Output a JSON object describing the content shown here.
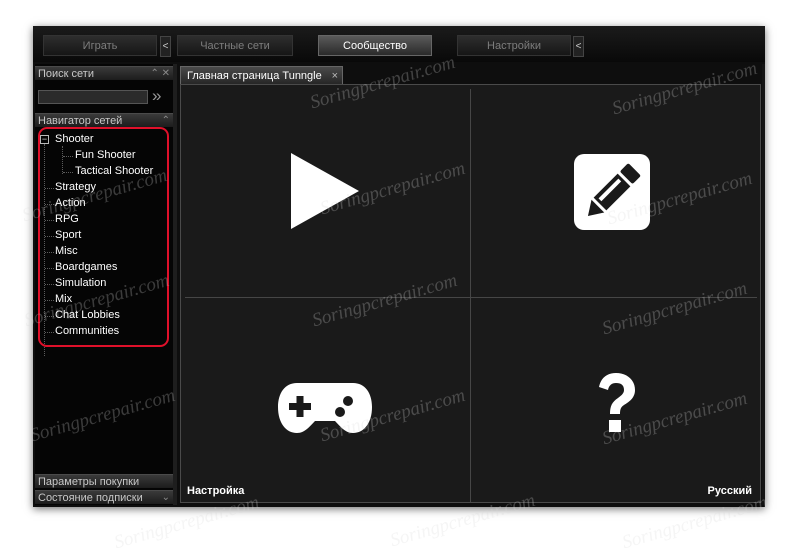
{
  "tabs": [
    {
      "label": "Играть",
      "active": false
    },
    {
      "label": "Частные сети",
      "active": false
    },
    {
      "label": "Сообщество",
      "active": true
    },
    {
      "label": "Настройки",
      "active": false
    }
  ],
  "arrow_glyph": "<",
  "search_panel": {
    "title": "Поиск сети",
    "input_value": ""
  },
  "navigator": {
    "title": "Навигатор сетей",
    "tree": {
      "root": "Shooter",
      "children": [
        "Fun Shooter",
        "Tactical Shooter"
      ],
      "siblings": [
        "Strategy",
        "Action",
        "RPG",
        "Sport",
        "Misc",
        "Boardgames",
        "Simulation",
        "Mix",
        "Chat Lobbies",
        "Communities"
      ]
    }
  },
  "bottom_panels": [
    "Параметры покупки",
    "Состояние подписки"
  ],
  "doc_tab": {
    "title": "Главная страница Tunngle",
    "close": "×"
  },
  "quadrants": {
    "top_left": "play-icon",
    "top_right": "edit-icon",
    "bottom_left": "gamepad-icon",
    "bottom_right": "help-icon"
  },
  "footer": {
    "left": "Настройка",
    "right": "Русский"
  },
  "watermark_text": "Soringpcrepair.com",
  "colors": {
    "highlight": "#e0102a",
    "background": "#1a1a1a",
    "active_tab": "#4a4a4a"
  }
}
